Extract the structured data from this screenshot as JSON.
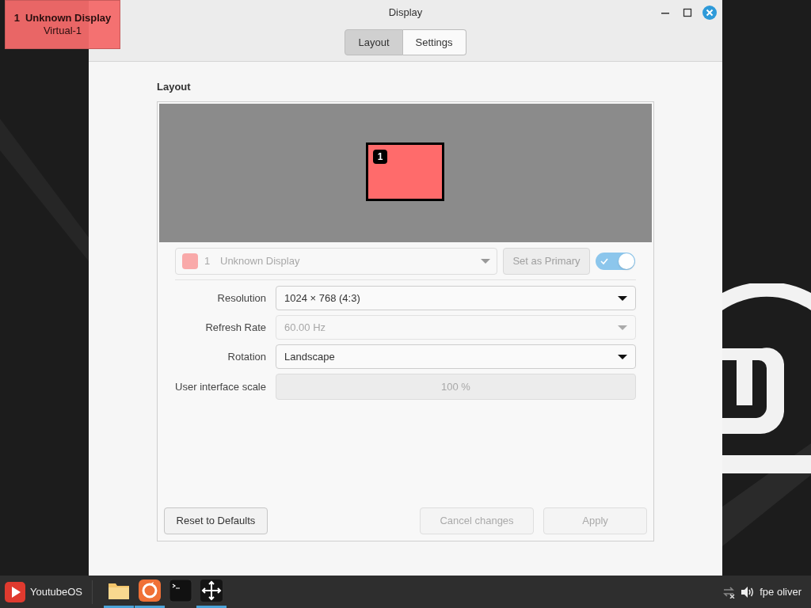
{
  "window": {
    "title": "Display"
  },
  "tabs": [
    {
      "label": "Layout",
      "selected": true
    },
    {
      "label": "Settings",
      "selected": false
    }
  ],
  "section_title": "Layout",
  "preview": {
    "monitors": [
      {
        "number": "1",
        "color": "#ff6b6b"
      }
    ]
  },
  "display_selector": {
    "number": "1",
    "name": "Unknown Display",
    "color": "#f9a9a9",
    "disabled": true
  },
  "set_primary": {
    "label": "Set as Primary",
    "disabled": true
  },
  "enabled_toggle": {
    "on": true
  },
  "settings": [
    {
      "kind": "combo",
      "label": "Resolution",
      "value": "1024 × 768 (4:3)",
      "disabled": false
    },
    {
      "kind": "combo",
      "label": "Refresh Rate",
      "value": "60.00 Hz",
      "disabled": true
    },
    {
      "kind": "combo",
      "label": "Rotation",
      "value": "Landscape",
      "disabled": false
    },
    {
      "kind": "scale",
      "label": "User interface scale",
      "value": "100 %",
      "disabled": true
    }
  ],
  "buttons": [
    {
      "label": "Reset to Defaults",
      "disabled": false
    },
    {
      "label": "Cancel changes",
      "disabled": true
    },
    {
      "label": "Apply",
      "disabled": true
    }
  ],
  "identify_overlay": {
    "number": "1",
    "name": "Unknown Display",
    "connector": "Virtual-1"
  },
  "taskbar": {
    "menu_label": "YoutubeOS",
    "launchers": [
      {
        "kind": "folder",
        "running": true
      },
      {
        "kind": "browser",
        "running": true
      },
      {
        "kind": "terminal",
        "running": false
      },
      {
        "kind": "display",
        "running": true
      }
    ],
    "user": "fpe oliver"
  }
}
